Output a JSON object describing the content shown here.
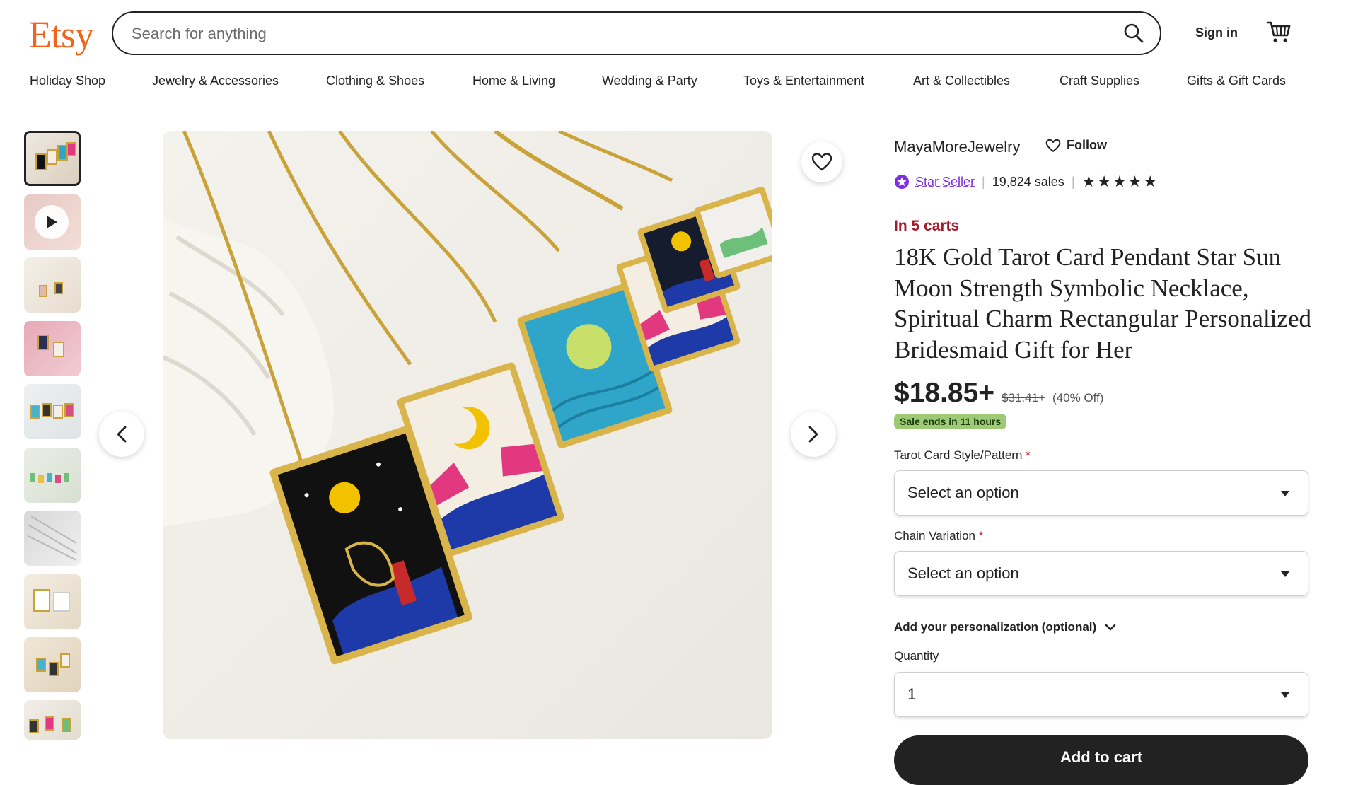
{
  "header": {
    "logo": "Etsy",
    "search_placeholder": "Search for anything",
    "sign_in": "Sign in"
  },
  "nav": [
    "Holiday Shop",
    "Jewelry & Accessories",
    "Clothing & Shoes",
    "Home & Living",
    "Wedding & Party",
    "Toys & Entertainment",
    "Art & Collectibles",
    "Craft Supplies",
    "Gifts & Gift Cards"
  ],
  "listing": {
    "shop_name": "MayaMoreJewelry",
    "follow_label": "Follow",
    "star_seller_label": "Star Seller",
    "sales": "19,824 sales",
    "rating_stars": 5,
    "stars_display": "★★★★★",
    "carts_text": "In 5 carts",
    "title": "18K Gold Tarot Card Pendant Star Sun Moon Strength Symbolic Necklace, Spiritual Charm Rectangular Personalized Bridesmaid Gift for Her",
    "price": "$18.85+",
    "original_price": "$31.41+",
    "discount": "(40% Off)",
    "sale_badge": "Sale ends in 11 hours",
    "option1_label": "Tarot Card Style/Pattern",
    "option1_value": "Select an option",
    "option2_label": "Chain Variation",
    "option2_value": "Select an option",
    "required_mark": "*",
    "personalization_label": "Add your personalization (optional)",
    "quantity_label": "Quantity",
    "quantity_value": "1",
    "add_to_cart": "Add to cart"
  },
  "colors": {
    "brand": "#F1641E",
    "carts_red": "#A61A2E",
    "star_seller_purple": "#7f2fe0",
    "sale_green": "#9ec975"
  },
  "icons": [
    "search-icon",
    "cart-icon",
    "heart-icon",
    "play-icon",
    "chevron-left-icon",
    "chevron-right-icon",
    "chevron-down-icon",
    "star-seller-icon"
  ]
}
